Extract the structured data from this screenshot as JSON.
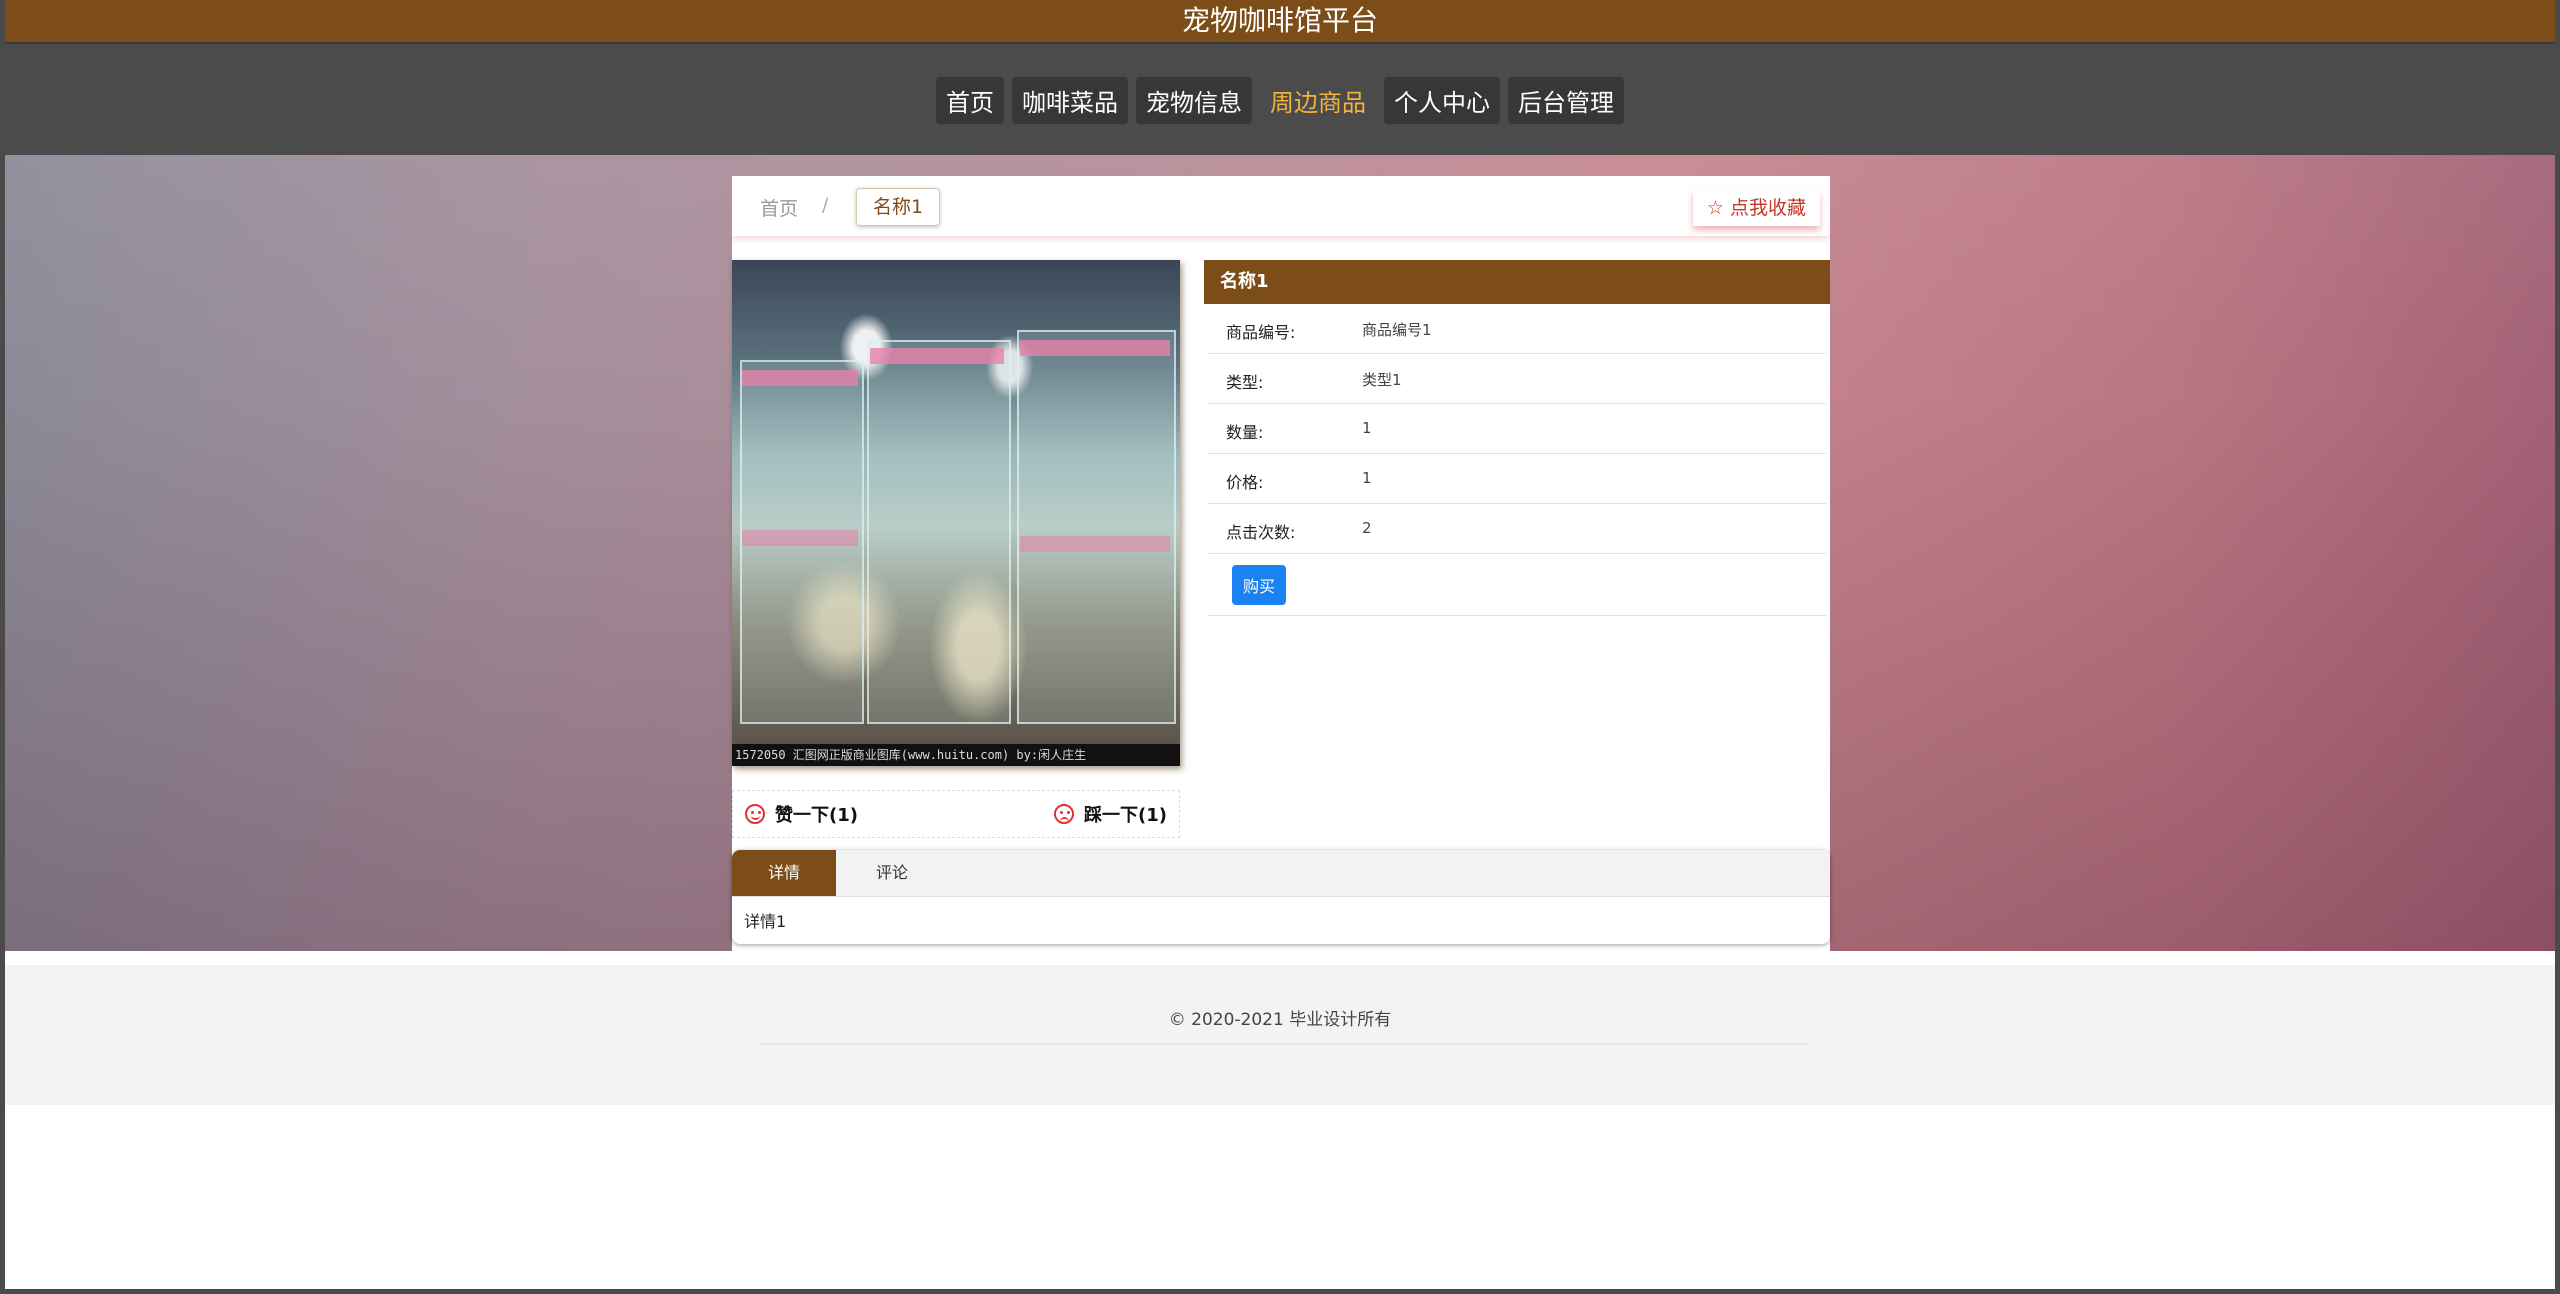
{
  "site": {
    "title": "宠物咖啡馆平台"
  },
  "nav": {
    "items": [
      {
        "label": "首页"
      },
      {
        "label": "咖啡菜品"
      },
      {
        "label": "宠物信息"
      },
      {
        "label": "周边商品"
      },
      {
        "label": "个人中心"
      },
      {
        "label": "后台管理"
      }
    ],
    "active_index": 3
  },
  "breadcrumb": {
    "home": "首页",
    "separator": "/",
    "current": "名称1"
  },
  "favorite": {
    "label": "☆ 点我收藏"
  },
  "photo": {
    "caption": "1572050  汇图网正版商业图库(www.huitu.com) by:闲人庄生"
  },
  "votes": {
    "like_label": "赞一下(1)",
    "dislike_label": "踩一下(1)"
  },
  "product": {
    "name": "名称1",
    "fields": [
      {
        "label": "商品编号:",
        "value": "商品编号1"
      },
      {
        "label": "类型:",
        "value": "类型1"
      },
      {
        "label": "数量:",
        "value": "1"
      },
      {
        "label": "价格:",
        "value": "1"
      },
      {
        "label": "点击次数:",
        "value": "2"
      }
    ],
    "buy_label": "购买"
  },
  "tabs": {
    "items": [
      {
        "label": "详情"
      },
      {
        "label": "评论"
      }
    ],
    "content": "详情1"
  },
  "footer": {
    "copyright": "© 2020-2021 毕业设计所有"
  },
  "colors": {
    "brand": "#7c4c19",
    "nav_bg": "#4b4b4b",
    "active_nav": "#f0b43a",
    "buy": "#1b82f2"
  }
}
